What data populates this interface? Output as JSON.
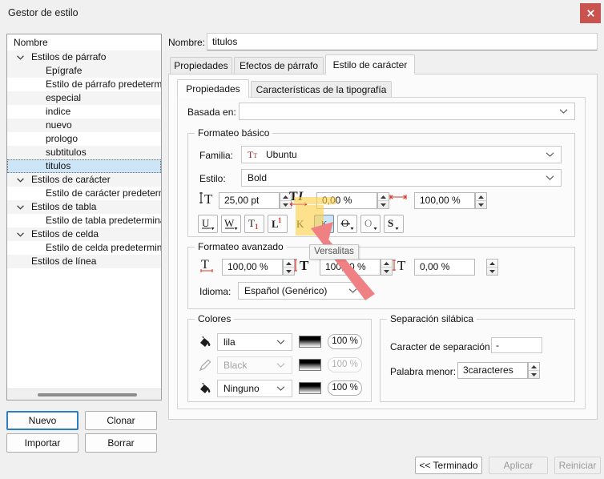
{
  "window": {
    "title": "Gestor de estilo",
    "close_icon": "close-icon"
  },
  "tree": {
    "header": "Nombre",
    "items": [
      {
        "label": "Estilos de párrafo",
        "level": 0,
        "expanded": true
      },
      {
        "label": "Epígrafe",
        "level": 1
      },
      {
        "label": "Estilo de párrafo predeterminado",
        "level": 1
      },
      {
        "label": "especial",
        "level": 1
      },
      {
        "label": "indice",
        "level": 1
      },
      {
        "label": "nuevo",
        "level": 1
      },
      {
        "label": "prologo",
        "level": 1
      },
      {
        "label": "subtitulos",
        "level": 1
      },
      {
        "label": "titulos",
        "level": 1,
        "selected": true
      },
      {
        "label": "Estilos de carácter",
        "level": 0,
        "expanded": true
      },
      {
        "label": "Estilo de carácter predeterminado",
        "level": 1
      },
      {
        "label": "Estilos de tabla",
        "level": 0,
        "expanded": true
      },
      {
        "label": "Estilo de tabla predeterminado",
        "level": 1
      },
      {
        "label": "Estilos de celda",
        "level": 0,
        "expanded": true
      },
      {
        "label": "Estilo de celda predeterminado",
        "level": 1
      },
      {
        "label": "Estilos de línea",
        "level": 0,
        "expanded": false
      }
    ]
  },
  "left_buttons": {
    "nuevo": "Nuevo",
    "clonar": "Clonar",
    "importar": "Importar",
    "borrar": "Borrar"
  },
  "name_field": {
    "label": "Nombre:",
    "value": "titulos"
  },
  "outer_tabs": [
    {
      "label": "Propiedades",
      "active": false
    },
    {
      "label": "Efectos de párrafo",
      "active": false
    },
    {
      "label": "Estilo de carácter",
      "active": true
    }
  ],
  "inner_tabs": [
    {
      "label": "Propiedades",
      "active": true
    },
    {
      "label": "Características de la tipografía",
      "active": false
    }
  ],
  "basada_en": {
    "label": "Basada en:",
    "value": "",
    "chevron_icon": "chevron-down-icon"
  },
  "formateo_basico": {
    "title": "Formateo básico",
    "familia_label": "Familia:",
    "familia_value": "Ubuntu",
    "familia_prefix_icon": "truetype-font-icon",
    "estilo_label": "Estilo:",
    "estilo_value": "Bold",
    "font_size": {
      "icon": "font-size-icon",
      "value": "25,00 pt"
    },
    "slant": {
      "icon": "italic-slant-icon",
      "value": "0,00 %"
    },
    "width": {
      "icon": "horizontal-scale-icon",
      "value": "100,00 %"
    },
    "toggle_buttons": [
      {
        "name": "underline-button",
        "glyph": "U",
        "state": "off"
      },
      {
        "name": "underline-words-button",
        "glyph": "W",
        "state": "off"
      },
      {
        "name": "subscript-button",
        "glyph": "T",
        "state": "off"
      },
      {
        "name": "superscript-button",
        "glyph": "L",
        "state": "off"
      },
      {
        "name": "kerning-button",
        "glyph": "K",
        "state": "flat"
      },
      {
        "name": "small-caps-button",
        "glyph": "ᴋ",
        "state": "on"
      },
      {
        "name": "strikethrough-button",
        "glyph": "Θ",
        "state": "off"
      },
      {
        "name": "outline-button",
        "glyph": "O",
        "state": "off"
      },
      {
        "name": "shadow-button",
        "glyph": "S",
        "state": "off"
      }
    ]
  },
  "formateo_avanzado": {
    "title": "Formateo avanzado",
    "baseline": {
      "icon": "baseline-shift-icon",
      "value": "100,00 %"
    },
    "width": {
      "icon": "char-width-icon",
      "value": "100,00 %"
    },
    "height": {
      "icon": "char-height-icon",
      "value": "0,00 %"
    },
    "idioma_label": "Idioma:",
    "idioma_value": "Español (Genérico)"
  },
  "colores": {
    "title": "Colores",
    "rows": [
      {
        "icon": "fill-bucket-icon",
        "color": "lila",
        "shade": "100 %",
        "disabled": false
      },
      {
        "icon": "pen-stroke-icon",
        "color": "Black",
        "shade": "100 %",
        "disabled": true
      },
      {
        "icon": "fill-bucket-icon",
        "color": "Ninguno",
        "shade": "100 %",
        "disabled": false
      }
    ]
  },
  "separacion_silabica": {
    "title": "Separación silábica",
    "caracter_label": "Caracter de separación silábica:",
    "caracter_value": "-",
    "palabra_label": "Palabra menor:",
    "palabra_value": "3caracteres"
  },
  "tooltip": {
    "text": "Versalitas"
  },
  "bottom_buttons": {
    "terminado": "<< Terminado",
    "aplicar": "Aplicar",
    "reiniciar": "Reiniciar"
  },
  "annotation": {
    "highlight_color": "#fdd049",
    "arrow_color": "#ef8083"
  }
}
